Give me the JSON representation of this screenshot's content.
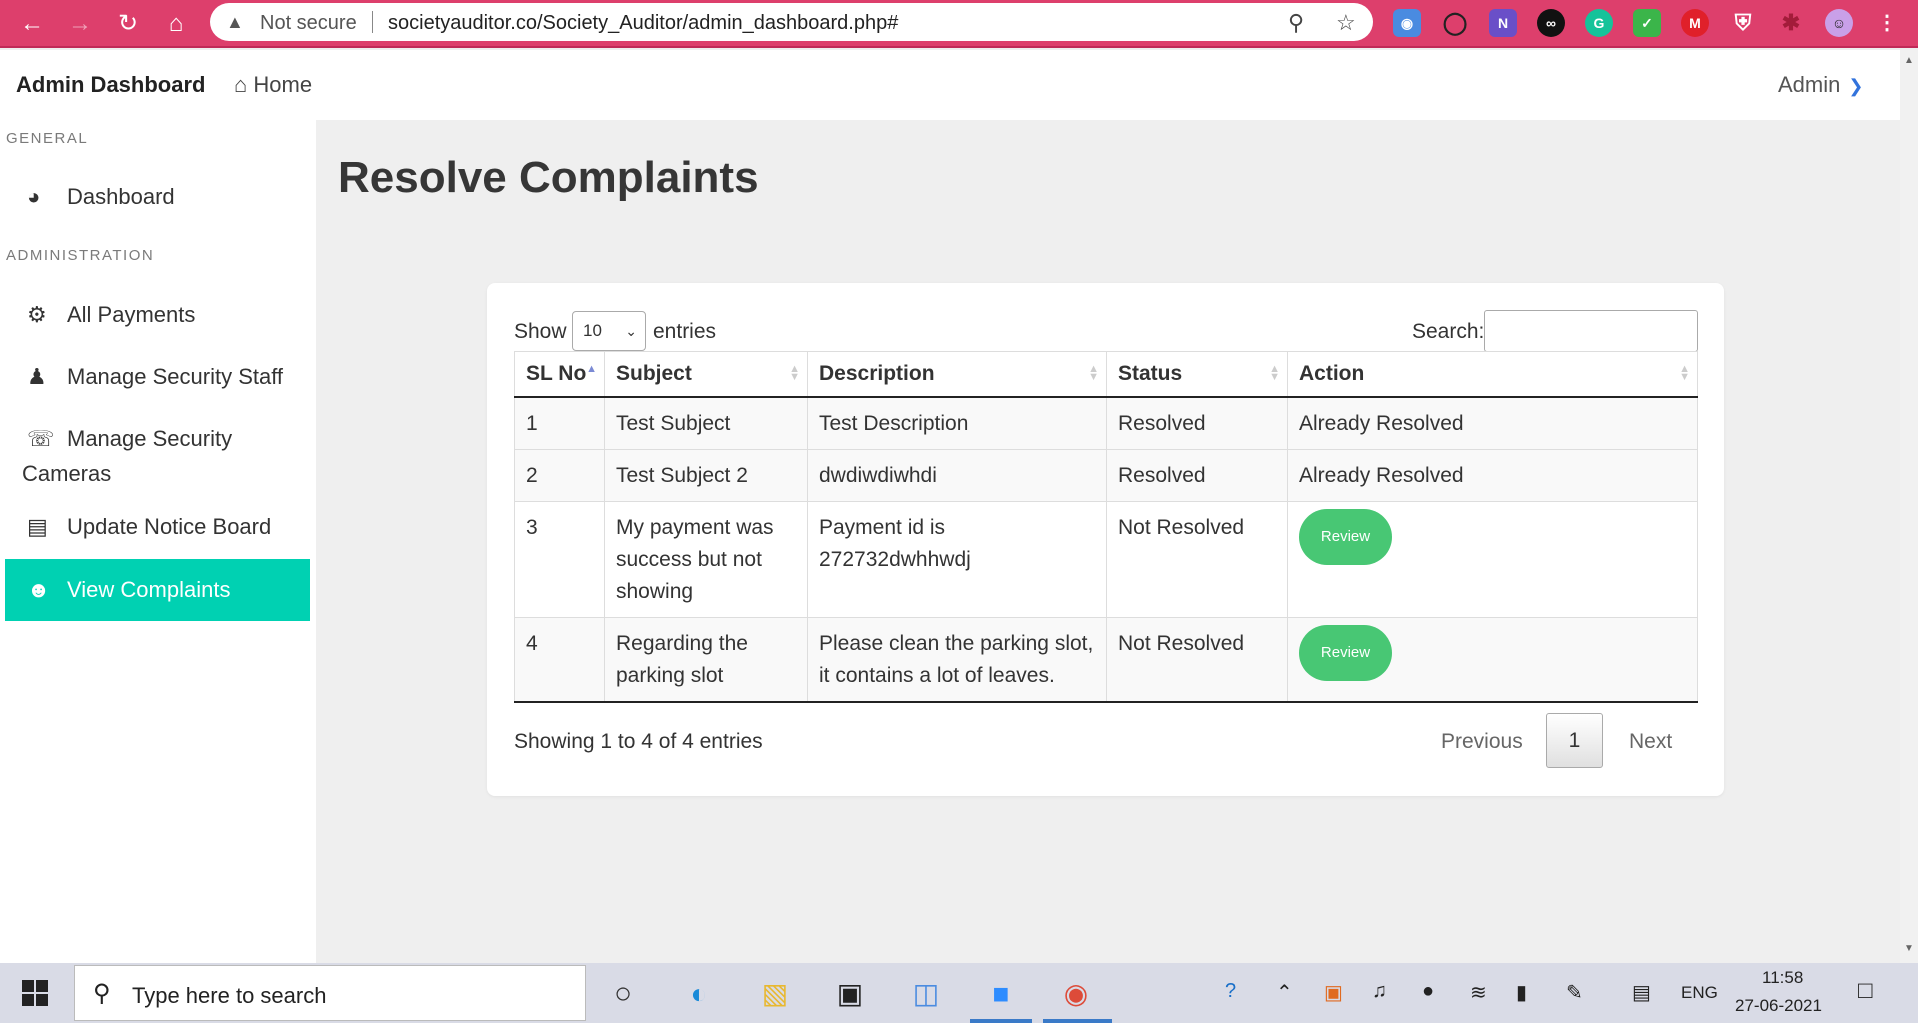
{
  "browser": {
    "security_label": "Not secure",
    "url": "societyauditor.co/Society_Auditor/admin_dashboard.php#"
  },
  "header": {
    "brand": "Admin Dashboard",
    "home": "Home",
    "user": "Admin"
  },
  "sidebar": {
    "general_label": "GENERAL",
    "admin_label": "ADMINISTRATION",
    "items": [
      {
        "label": "Dashboard",
        "icon": "tachometer-icon"
      },
      {
        "label": "All Payments",
        "icon": "gears-icon"
      },
      {
        "label": "Manage Security Staff",
        "icon": "users-cog-icon"
      },
      {
        "label": "Manage Security",
        "label2": "Cameras",
        "icon": "headset-icon"
      },
      {
        "label": "Update Notice Board",
        "icon": "clipboard-icon"
      },
      {
        "label": "View Complaints",
        "icon": "user-secret-icon",
        "active": true
      }
    ]
  },
  "main": {
    "title": "Resolve Complaints",
    "show_label": "Show",
    "entries_value": "10",
    "entries_label": "entries",
    "search_label": "Search:",
    "search_value": "",
    "columns": [
      "SL No",
      "Subject",
      "Description",
      "Status",
      "Action"
    ],
    "rows": [
      {
        "sl": "1",
        "subject": "Test Subject",
        "description": "Test Description",
        "status": "Resolved",
        "action": "Already Resolved"
      },
      {
        "sl": "2",
        "subject": "Test Subject 2",
        "description": "dwdiwdiwhdi",
        "status": "Resolved",
        "action": "Already Resolved"
      },
      {
        "sl": "3",
        "subject": "My payment was success but not showing",
        "description": "Payment id is 272732dwhhwdj",
        "status": "Not Resolved",
        "action": "Review"
      },
      {
        "sl": "4",
        "subject": "Regarding the parking slot",
        "description": "Please clean the parking slot, it contains a lot of leaves.",
        "status": "Not Resolved",
        "action": "Review"
      }
    ],
    "info": "Showing 1 to 4 of 4 entries",
    "pagination": {
      "previous": "Previous",
      "page": "1",
      "next": "Next"
    }
  },
  "taskbar": {
    "search_placeholder": "Type here to search",
    "lang": "ENG",
    "time": "11:58",
    "date": "27-06-2021"
  },
  "colors": {
    "browser_bar": "#dd3f6c",
    "active_menu": "#00d1b2",
    "review_button": "#48c774",
    "admin_caret": "#3273dc"
  }
}
